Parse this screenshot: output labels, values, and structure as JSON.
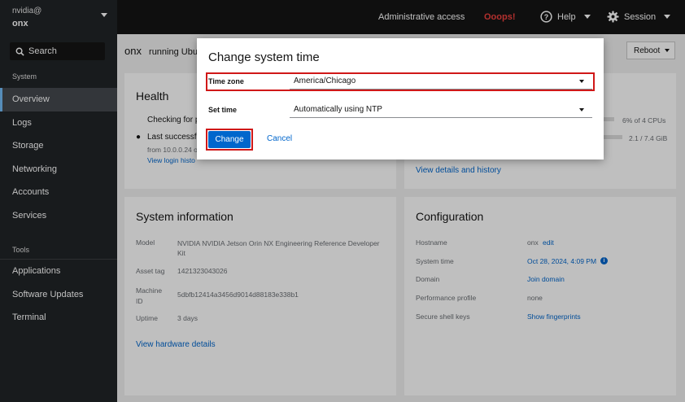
{
  "sidebar": {
    "user": "nvidia@",
    "host": "onx",
    "search_label": "Search",
    "system_section": "System",
    "items": [
      "Overview",
      "Logs",
      "Storage",
      "Networking",
      "Accounts",
      "Services"
    ],
    "tools_section": "Tools",
    "tools_items": [
      "Applications",
      "Software Updates",
      "Terminal"
    ],
    "active": "Overview"
  },
  "topbar": {
    "admin": "Administrative access",
    "ooops": "Ooops!",
    "help": "Help",
    "session": "Session"
  },
  "main": {
    "hostname": "onx",
    "running": "running Ubu",
    "reboot": "Reboot",
    "health": {
      "title": "Health",
      "checking": "Checking for p",
      "last_login": "Last successfu",
      "from": "from 10.0.0.24 o",
      "view_history": "View login histo"
    },
    "usage": {
      "cpu": "6% of 4 CPUs",
      "mem": "2.1 / 7.4 GiB",
      "view_details": "View details and history"
    },
    "sysinfo": {
      "title": "System information",
      "model_label": "Model",
      "model_value": "NVIDIA NVIDIA Jetson Orin NX Engineering Reference Developer Kit",
      "asset_label": "Asset tag",
      "asset_value": "1421323043026",
      "machine_label": "Machine ID",
      "machine_value": "5dbfb12414a3456d9014d88183e338b1",
      "uptime_label": "Uptime",
      "uptime_value": "3 days",
      "view_hw": "View hardware details"
    },
    "config": {
      "title": "Configuration",
      "hostname_label": "Hostname",
      "hostname_value": "onx",
      "hostname_edit": "edit",
      "time_label": "System time",
      "time_value": "Oct 28, 2024, 4:09 PM",
      "domain_label": "Domain",
      "domain_value": "Join domain",
      "perf_label": "Performance profile",
      "perf_value": "none",
      "ssh_label": "Secure shell keys",
      "ssh_value": "Show fingerprints"
    }
  },
  "modal": {
    "title": "Change system time",
    "timezone_label": "Time zone",
    "timezone_value": "America/Chicago",
    "settime_label": "Set time",
    "settime_value": "Automatically using NTP",
    "change": "Change",
    "cancel": "Cancel"
  },
  "colors": {
    "accent": "#0066cc",
    "highlight": "#d01818",
    "sidebar": "#212427",
    "topbar": "#151515",
    "error": "#f0403e"
  },
  "icons": [
    "search-icon",
    "help-icon",
    "gear-icon",
    "user-icon",
    "info-icon",
    "chevron-down-icon"
  ]
}
